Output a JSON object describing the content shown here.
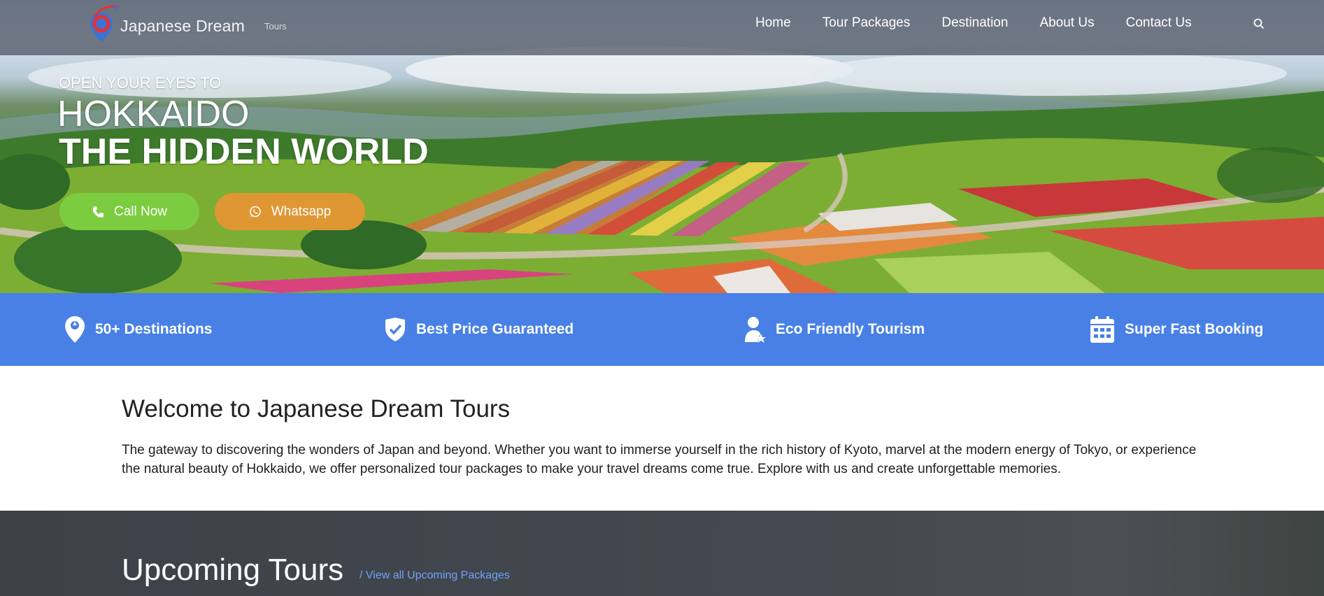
{
  "brand": {
    "name": "Japanese Dream",
    "tagline": "Tours"
  },
  "nav": {
    "items": [
      "Home",
      "Tour Packages",
      "Destination",
      "About Us",
      "Contact Us"
    ],
    "search_icon": "search-icon"
  },
  "hero": {
    "kicker": "OPEN YOUR EYES TO",
    "title": "HOKKAIDO",
    "subtitle": "THE HIDDEN WORLD",
    "call_button": "Call Now",
    "whatsapp_button": "Whatsapp"
  },
  "features": [
    {
      "label": "50+ Destinations",
      "icon": "location-pin-icon"
    },
    {
      "label": "Best Price Guaranteed",
      "icon": "shield-check-icon"
    },
    {
      "label": "Eco Friendly Tourism",
      "icon": "user-star-icon"
    },
    {
      "label": "Super Fast Booking",
      "icon": "calendar-icon"
    }
  ],
  "welcome": {
    "title": "Welcome to Japanese Dream Tours",
    "text": "The gateway to discovering the wonders of Japan and beyond. Whether you want to immerse yourself in the rich history of Kyoto, marvel at the modern energy of Tokyo, or experience the natural beauty of Hokkaido, we offer personalized tour packages to make your travel dreams come true. Explore with us and create unforgettable memories."
  },
  "upcoming": {
    "title": "Upcoming Tours",
    "link": "/ View all Upcoming Packages"
  },
  "colors": {
    "feature_bar": "#4880e6",
    "call_button": "#7ccc3f",
    "whatsapp_button": "#df9733",
    "link": "#6ea4f7"
  }
}
